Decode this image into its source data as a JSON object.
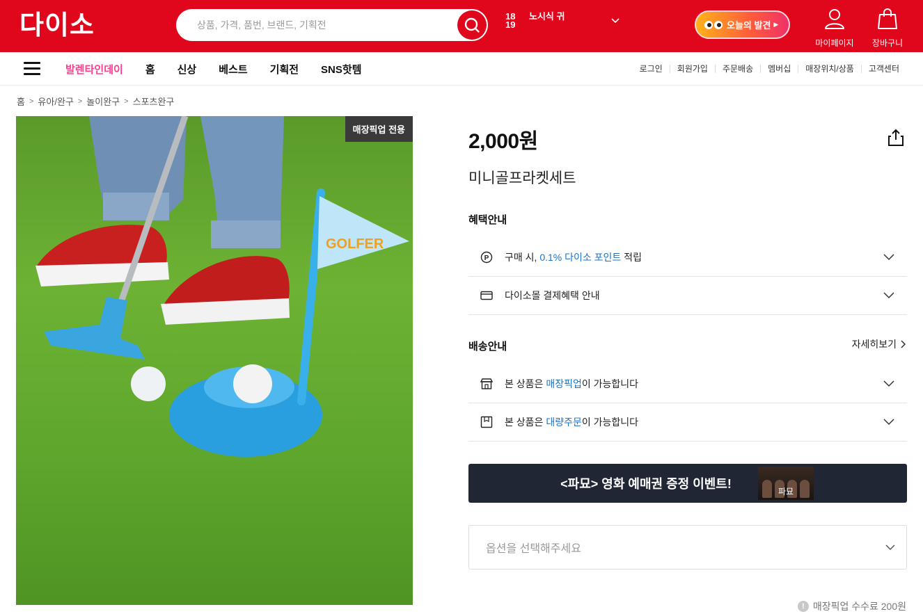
{
  "header": {
    "logo": "다이소",
    "search_placeholder": "상품, 가격, 품번, 브랜드, 기획전",
    "store_number": "18 19",
    "store_name": "노시식 귀",
    "discover_label": "오늘의 발견",
    "mypage_label": "마이페이지",
    "cart_label": "장바구니"
  },
  "nav": {
    "main": [
      "발렌타인데이",
      "홈",
      "신상",
      "베스트",
      "기획전",
      "SNS핫템"
    ],
    "util": [
      "로그인",
      "회원가입",
      "주문배송",
      "멤버십",
      "매장위치/상품",
      "고객센터"
    ]
  },
  "breadcrumb": [
    "홈",
    "유아/완구",
    "놀이완구",
    "스포츠완구"
  ],
  "product": {
    "badge": "매장픽업 전용",
    "price": "2,000원",
    "name": "미니골프라켓세트",
    "image_sign_text": "GOLFER"
  },
  "benefits": {
    "title": "혜택안내",
    "point_prefix": "구매 시, ",
    "point_highlight": "0.1% 다이소 포인트",
    "point_suffix": " 적립",
    "payment": "다이소몰 결제혜택 안내"
  },
  "delivery": {
    "title": "배송안내",
    "detail_link": "자세히보기",
    "pickup_prefix": "본 상품은 ",
    "pickup_highlight": "매장픽업",
    "pickup_suffix": "이 가능합니다",
    "bulk_prefix": "본 상품은 ",
    "bulk_highlight": "대량주문",
    "bulk_suffix": "이 가능합니다"
  },
  "event": {
    "text": "<파묘> 영화 예매권 증정 이벤트!",
    "poster_title": "파묘"
  },
  "option": {
    "placeholder": "옵션을 선택해주세요"
  },
  "fee_note": "매장픽업 수수료 200원",
  "colors": {
    "brand_red": "#e0061c",
    "link_blue": "#1a73c8",
    "valentine_pink": "#ff3d8b",
    "banner_dark": "#202634"
  }
}
